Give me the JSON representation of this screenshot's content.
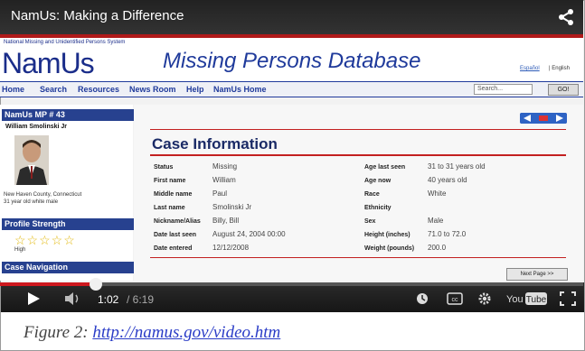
{
  "video": {
    "title": "NamUs: Making a Difference",
    "current_time": "1:02",
    "total_time": "/ 6:19",
    "progress": 0.164,
    "youtube_logo": "YouTube"
  },
  "site": {
    "logo_small": "National Missing and Unidentified Persons System",
    "logo_big": "NamUs",
    "db_title": "Missing Persons Database",
    "lang_es": "Español",
    "lang_en": "| English",
    "nav": [
      "Home",
      "Search",
      "Resources",
      "News Room",
      "Help",
      "NamUs Home"
    ],
    "search_placeholder": "Search...",
    "go_label": "GO!"
  },
  "sidebar": {
    "case_id": "NamUs MP # 43",
    "person_name": "William Smolinski Jr",
    "location": "New Haven County, Connecticut",
    "age_desc": "31 year old white male",
    "profile_strength": "Profile Strength",
    "rating_label": "High",
    "case_nav": "Case Navigation"
  },
  "case": {
    "title": "Case Information",
    "left": [
      {
        "label": "Status",
        "value": "Missing"
      },
      {
        "label": "First name",
        "value": "William"
      },
      {
        "label": "Middle name",
        "value": "Paul"
      },
      {
        "label": "Last name",
        "value": "Smolinski Jr"
      },
      {
        "label": "Nickname/Alias",
        "value": "Billy, Bill"
      },
      {
        "label": "Date last seen",
        "value": "August 24, 2004 00:00"
      },
      {
        "label": "Date entered",
        "value": "12/12/2008"
      }
    ],
    "right": [
      {
        "label": "Age last seen",
        "value": "31 to 31 years old"
      },
      {
        "label": "Age now",
        "value": "40 years old"
      },
      {
        "label": "Race",
        "value": "White"
      },
      {
        "label": "Ethnicity",
        "value": ""
      },
      {
        "label": "Sex",
        "value": "Male"
      },
      {
        "label": "Height (inches)",
        "value": "71.0 to 72.0"
      },
      {
        "label": "Weight (pounds)",
        "value": "200.0"
      }
    ],
    "next_page": "Next Page >>"
  },
  "caption": {
    "prefix": "Figure 2: ",
    "link": "http://namus.gov/video.htm"
  },
  "colors": {
    "accent_red": "#c32020",
    "nav_blue": "#1f3a9b"
  }
}
